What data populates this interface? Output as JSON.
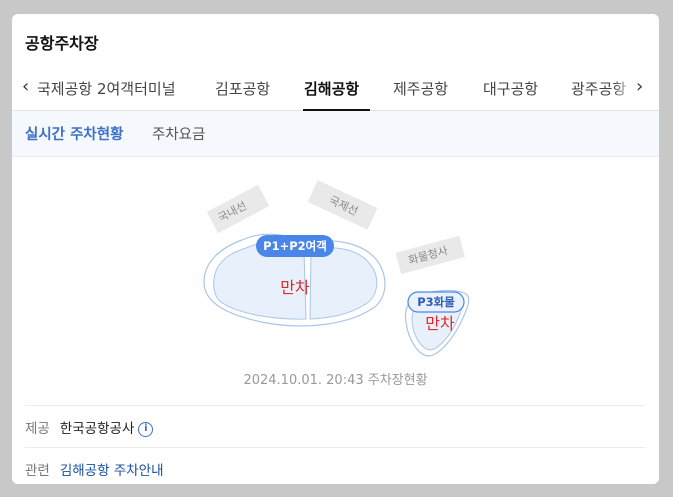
{
  "title": "공항주차장",
  "tabs": [
    {
      "label": "국제공항 2여객터미널"
    },
    {
      "label": "김포공항"
    },
    {
      "label": "김해공항"
    },
    {
      "label": "제주공항"
    },
    {
      "label": "대구공항"
    },
    {
      "label": "광주공항"
    }
  ],
  "active_tab": "김해공항",
  "subtabs": [
    {
      "label": "실시간 주차현황"
    },
    {
      "label": "주차요금"
    }
  ],
  "map": {
    "domestic_label": "국내선",
    "international_label": "국제선",
    "cargo_building_label": "화물청사",
    "lot_main_badge": "P1+P2여객",
    "lot_main_status": "만차",
    "lot_cargo_badge": "P3화물",
    "lot_cargo_status": "만차",
    "status_color": "#e02a2a",
    "badge_color": "#4a86e8"
  },
  "timestamp": "2024.10.01. 20:43 주차장현황",
  "provider": {
    "label": "제공",
    "value": "한국공항공사",
    "icon": "info-icon"
  },
  "related": {
    "label": "관련",
    "link": "김해공항 주차안내"
  }
}
